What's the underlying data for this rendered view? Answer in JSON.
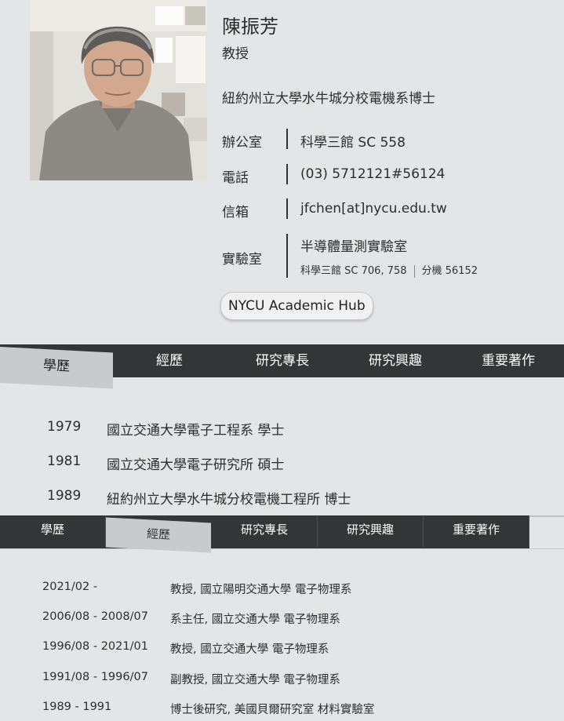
{
  "profile": {
    "name": "陳振芳",
    "title": "教授",
    "degree": "紐約州立大學水牛城分校電機系博士",
    "office_label": "辦公室",
    "office_value": "科學三館 SC 558",
    "phone_label": "電話",
    "phone_value": "(03) 5712121#56124",
    "email_label": "信箱",
    "email_value": "jfchen[at]nycu.edu.tw",
    "lab_label": "實驗室",
    "lab_name": "半導體量測實驗室",
    "lab_location": "科學三館 SC 706, 758",
    "lab_ext": "分機 56152",
    "hub_button": "NYCU Academic Hub"
  },
  "tabs": [
    "學歷",
    "經歷",
    "研究專長",
    "研究興趣",
    "重要著作"
  ],
  "education": [
    {
      "year": "1979",
      "text": "國立交通大學電子工程系 學士"
    },
    {
      "year": "1981",
      "text": "國立交通大學電子研究所 碩士"
    },
    {
      "year": "1989",
      "text": "紐約州立大學水牛城分校電機工程所 博士"
    }
  ],
  "experience": [
    {
      "date": "2021/02 -",
      "text": "教授, 國立陽明交通大學 電子物理系"
    },
    {
      "date": "2006/08 - 2008/07",
      "text": "系主任, 國立交通大學 電子物理系"
    },
    {
      "date": "1996/08 - 2021/01",
      "text": "教授, 國立交通大學 電子物理系"
    },
    {
      "date": "1991/08 - 1996/07",
      "text": "副教授, 國立交通大學 電子物理系"
    },
    {
      "date": "1989 - 1991",
      "text": "博士後研究, 美國貝爾研究室 材料實驗室"
    }
  ]
}
